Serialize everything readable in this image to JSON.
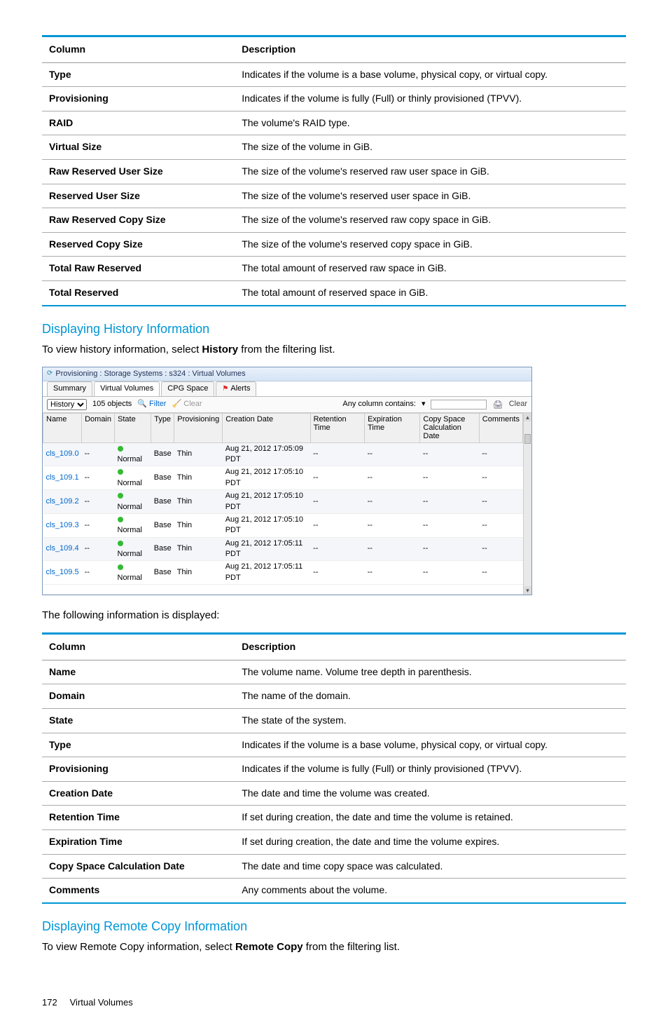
{
  "table1": {
    "headers": [
      "Column",
      "Description"
    ],
    "rows": [
      [
        "Type",
        "Indicates if the volume is a base volume, physical copy, or virtual copy."
      ],
      [
        "Provisioning",
        "Indicates if the volume is fully (Full) or thinly provisioned (TPVV)."
      ],
      [
        "RAID",
        "The volume's RAID type."
      ],
      [
        "Virtual Size",
        "The size of the volume in GiB."
      ],
      [
        "Raw Reserved User Size",
        "The size of the volume's reserved raw user space in GiB."
      ],
      [
        "Reserved User Size",
        "The size of the volume's reserved user space in GiB."
      ],
      [
        "Raw Reserved Copy Size",
        "The size of the volume's reserved raw copy space in GiB."
      ],
      [
        "Reserved Copy Size",
        "The size of the volume's reserved copy space in GiB."
      ],
      [
        "Total Raw Reserved",
        "The total amount of reserved raw space in GiB."
      ],
      [
        "Total Reserved",
        "The total amount of reserved space in GiB."
      ]
    ]
  },
  "section_history": {
    "heading": "Displaying History Information",
    "intro_pre": "To view history information, select ",
    "intro_bold": "History",
    "intro_post": " from the filtering list."
  },
  "shot": {
    "title": "Provisioning : Storage Systems : s324 : Virtual Volumes",
    "tabs": [
      "Summary",
      "Virtual Volumes",
      "CPG Space",
      "Alerts"
    ],
    "toolbar": {
      "filter_select": [
        "History"
      ],
      "count": "105 objects",
      "filter": "Filter",
      "clear_link": "Clear",
      "any_col": "Any column contains:",
      "clear_btn": "Clear"
    },
    "columns": [
      "Name",
      "Domain",
      "State",
      "Type",
      "Provisioning",
      "Creation Date",
      "Retention Time",
      "Expiration Time",
      "Copy Space Calculation Date",
      "Comments"
    ],
    "rows": [
      {
        "name": "cls_109.0",
        "domain": "--",
        "state": "Normal",
        "type": "Base",
        "prov": "Thin",
        "cdate": "Aug 21, 2012 17:05:09 PDT",
        "ret": "--",
        "exp": "--",
        "csc": "--",
        "com": "--"
      },
      {
        "name": "cls_109.1",
        "domain": "--",
        "state": "Normal",
        "type": "Base",
        "prov": "Thin",
        "cdate": "Aug 21, 2012 17:05:10 PDT",
        "ret": "--",
        "exp": "--",
        "csc": "--",
        "com": "--"
      },
      {
        "name": "cls_109.2",
        "domain": "--",
        "state": "Normal",
        "type": "Base",
        "prov": "Thin",
        "cdate": "Aug 21, 2012 17:05:10 PDT",
        "ret": "--",
        "exp": "--",
        "csc": "--",
        "com": "--"
      },
      {
        "name": "cls_109.3",
        "domain": "--",
        "state": "Normal",
        "type": "Base",
        "prov": "Thin",
        "cdate": "Aug 21, 2012 17:05:10 PDT",
        "ret": "--",
        "exp": "--",
        "csc": "--",
        "com": "--"
      },
      {
        "name": "cls_109.4",
        "domain": "--",
        "state": "Normal",
        "type": "Base",
        "prov": "Thin",
        "cdate": "Aug 21, 2012 17:05:11 PDT",
        "ret": "--",
        "exp": "--",
        "csc": "--",
        "com": "--"
      },
      {
        "name": "cls_109.5",
        "domain": "--",
        "state": "Normal",
        "type": "Base",
        "prov": "Thin",
        "cdate": "Aug 21, 2012 17:05:11 PDT",
        "ret": "--",
        "exp": "--",
        "csc": "--",
        "com": "--"
      }
    ]
  },
  "following_info": "The following information is displayed:",
  "table2": {
    "headers": [
      "Column",
      "Description"
    ],
    "rows": [
      [
        "Name",
        "The volume name. Volume tree depth in parenthesis."
      ],
      [
        "Domain",
        "The name of the domain."
      ],
      [
        "State",
        "The state of the system."
      ],
      [
        "Type",
        "Indicates if the volume is a base volume, physical copy, or virtual copy."
      ],
      [
        "Provisioning",
        "Indicates if the volume is fully (Full) or thinly provisioned (TPVV)."
      ],
      [
        "Creation Date",
        "The date and time the volume was created."
      ],
      [
        "Retention Time",
        "If set during creation, the date and time the volume is retained."
      ],
      [
        "Expiration Time",
        "If set during creation, the date and time the volume expires."
      ],
      [
        "Copy Space Calculation Date",
        "The date and time copy space was calculated."
      ],
      [
        "Comments",
        "Any comments about the volume."
      ]
    ]
  },
  "section_remote": {
    "heading": "Displaying Remote Copy Information",
    "intro_pre": "To view Remote Copy information, select ",
    "intro_bold": "Remote Copy",
    "intro_post": " from the filtering list."
  },
  "footer": {
    "page": "172",
    "section": "Virtual Volumes"
  }
}
